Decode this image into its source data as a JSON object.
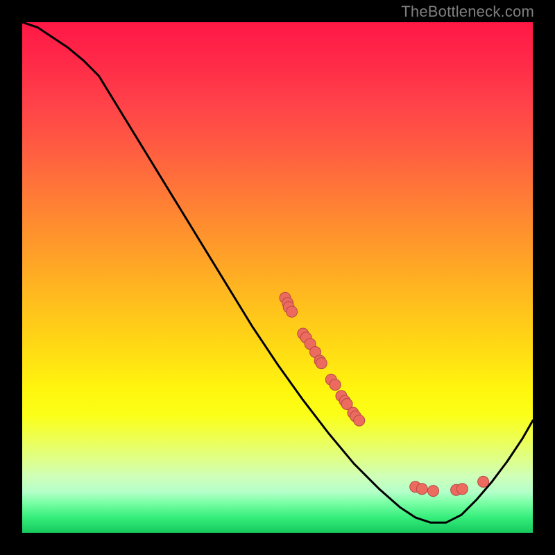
{
  "watermark": "TheBottleneck.com",
  "chart_data": {
    "type": "line",
    "title": "",
    "xlabel": "",
    "ylabel": "",
    "xlim": [
      0,
      100
    ],
    "ylim": [
      0,
      100
    ],
    "grid": false,
    "curve_points_xy": [
      [
        0,
        100
      ],
      [
        3,
        99
      ],
      [
        6,
        97
      ],
      [
        9,
        95
      ],
      [
        12,
        92.5
      ],
      [
        15,
        89.5
      ],
      [
        45,
        40.5
      ],
      [
        50,
        33
      ],
      [
        55,
        26
      ],
      [
        60,
        19.5
      ],
      [
        65,
        13.5
      ],
      [
        70,
        8.5
      ],
      [
        74,
        5
      ],
      [
        77,
        3
      ],
      [
        80,
        2
      ],
      [
        83,
        2
      ],
      [
        86,
        3.5
      ],
      [
        89,
        6.5
      ],
      [
        92,
        10
      ],
      [
        95,
        14
      ],
      [
        98,
        18.5
      ],
      [
        100,
        22
      ]
    ],
    "scatter_points_xy": [
      [
        51.5,
        46.0
      ],
      [
        52.0,
        45.0
      ],
      [
        52.2,
        44.2
      ],
      [
        52.8,
        43.3
      ],
      [
        55.0,
        39.0
      ],
      [
        55.6,
        38.2
      ],
      [
        56.4,
        37.0
      ],
      [
        57.4,
        35.4
      ],
      [
        58.3,
        33.7
      ],
      [
        58.6,
        33.2
      ],
      [
        60.5,
        30.0
      ],
      [
        61.3,
        29.0
      ],
      [
        62.5,
        26.8
      ],
      [
        63.2,
        25.8
      ],
      [
        63.6,
        25.2
      ],
      [
        64.8,
        23.5
      ],
      [
        65.3,
        22.8
      ],
      [
        66.0,
        22.0
      ],
      [
        77.0,
        9.0
      ],
      [
        78.3,
        8.6
      ],
      [
        80.5,
        8.2
      ],
      [
        85.0,
        8.4
      ],
      [
        86.2,
        8.6
      ],
      [
        90.3,
        10.0
      ]
    ],
    "colors": {
      "background_gradient_top": "#ff1846",
      "background_gradient_bottom": "#17c95e",
      "curve": "#000000",
      "points_fill": "#ed6a5e",
      "points_stroke": "#b24a45"
    }
  }
}
